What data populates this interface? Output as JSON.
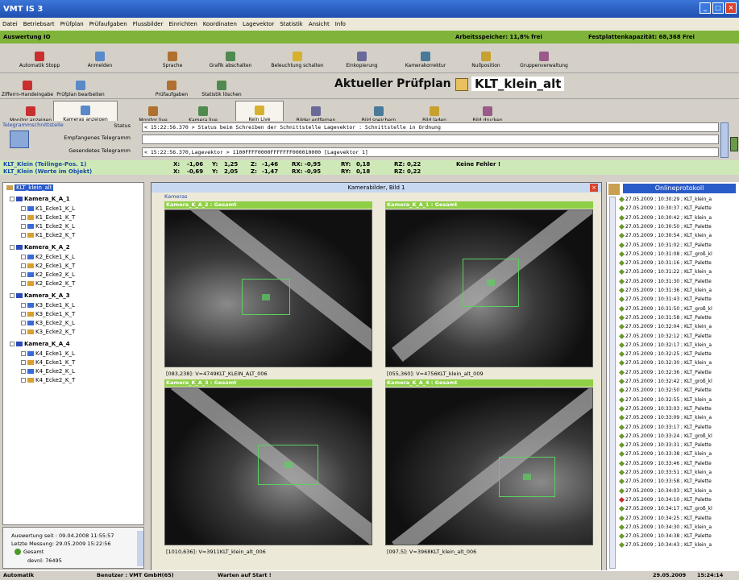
{
  "window": {
    "title": "VMT IS 3"
  },
  "menu": [
    "Datei",
    "Betriebsart",
    "Prüfplan",
    "Prüfaufgaben",
    "Flussbilder",
    "Einrichten",
    "Koordinaten",
    "Lagevektor",
    "Statistik",
    "Ansicht",
    "Info"
  ],
  "greenbar": {
    "left": "Auswertung IO",
    "memory": "Arbeitsspeicher: 11,8% frei",
    "disk": "Festplattenkapazität: 68,368 Frei"
  },
  "toolbar1": [
    {
      "label": "Automatik Stopp",
      "icon": "stop-icon"
    },
    {
      "label": "Anmelden",
      "icon": "user-icon"
    },
    {
      "label": "Sprache",
      "icon": "language-icon"
    },
    {
      "label": "Grafik abschalten",
      "icon": "graphic-icon"
    },
    {
      "label": "Beleuchtung schalten",
      "icon": "light-icon"
    },
    {
      "label": "Einkopierung",
      "icon": "copy-icon"
    },
    {
      "label": "Kamerakorrektur",
      "icon": "camera-correct-icon"
    },
    {
      "label": "Nullposition",
      "icon": "zero-icon"
    },
    {
      "label": "Gruppenverwaltung",
      "icon": "group-icon"
    }
  ],
  "toolbar2": [
    {
      "label": "Zifferrn-Handeingabe",
      "icon": "keypad-icon"
    },
    {
      "label": "Prüfplan bearbeiten",
      "icon": "edit-icon"
    },
    {
      "label": "Prüfaufgaben",
      "icon": "tasks-icon"
    },
    {
      "label": "Statistik löschen",
      "icon": "delete-stats-icon"
    }
  ],
  "plan": {
    "heading": "Aktueller Prüfplan",
    "name": "KLT_klein_alt"
  },
  "toolbar3": [
    {
      "label": "Monitor anzeigen",
      "icon": "monitor-icon"
    },
    {
      "label": "Kameras anzeigen",
      "icon": "cameras-icon",
      "pressed": true
    },
    {
      "label": "Monitor live",
      "icon": "monitor-live-icon"
    },
    {
      "label": "Kamera live",
      "icon": "camera-live-icon"
    },
    {
      "label": "Kein Live",
      "icon": "no-live-icon",
      "pressed": true
    },
    {
      "label": "Bilder entfernen",
      "icon": "remove-images-icon"
    },
    {
      "label": "Bild speichern",
      "icon": "save-image-icon"
    },
    {
      "label": "Bild laden",
      "icon": "load-image-icon"
    },
    {
      "label": "Bild drucken",
      "icon": "print-image-icon"
    }
  ],
  "telegram": {
    "section": "Telegrammschnittstelle",
    "status_label": "Status",
    "status": "< 15:22:56.370 > Status beim Schreiben der Schnittstelle Lagevektor :  Schnittstelle in Ordnung",
    "received_label": "Empfangenes Telegramm",
    "received": "",
    "sent_label": "Gesendetes Telegramm",
    "sent": "< 15:22:56.370,Lagevektor > 1100FFFF0000FFFFFFF000010000 [Lagevektor 1]"
  },
  "coord": [
    {
      "name": "KLT_Klein (Teilinge-Pos. 1)",
      "x": "-1,06",
      "y": "1,25",
      "z": "-1,46",
      "rx": "-0,95",
      "ry": "0,18",
      "rz": "0,22",
      "msg": "Keine Fehler !"
    },
    {
      "name": "KLT_Klein (Werte im Objekt)",
      "x": "-0,69",
      "y": "2,05",
      "z": "-1,47",
      "rx": "-0,95",
      "ry": "0,18",
      "rz": "0,22",
      "msg": ""
    }
  ],
  "coord_labels": {
    "x": "X:",
    "y": "Y:",
    "z": "Z:",
    "rx": "RX:",
    "ry": "RY:",
    "rz": "RZ:"
  },
  "tree": {
    "root": "KLT_klein_alt",
    "cameras": [
      {
        "name": "Kamera_K_A_1",
        "items": [
          "K1_Ecke1_K_L",
          "K1_Ecke1_K_T",
          "K1_Ecke2_K_L",
          "K1_Ecke2_K_T"
        ]
      },
      {
        "name": "Kamera_K_A_2",
        "items": [
          "K2_Ecke1_K_L",
          "K2_Ecke1_K_T",
          "K2_Ecke2_K_L",
          "K2_Ecke2_K_T"
        ]
      },
      {
        "name": "Kamera_K_A_3",
        "items": [
          "K3_Ecke1_K_L",
          "K3_Ecke1_K_T",
          "K3_Ecke2_K_L",
          "K3_Ecke2_K_T"
        ]
      },
      {
        "name": "Kamera_K_A_4",
        "items": [
          "K4_Ecke1_K_L",
          "K4_Ecke1_K_T",
          "K4_Ecke2_K_L",
          "K4_Ecke2_K_T"
        ]
      }
    ]
  },
  "leftinfo": {
    "line1": "Auswertung seit : 09.04.2008 11:55:57",
    "line2": "Letzte Messung: 29.05.2009 15:22:56",
    "line3": "Gesamt",
    "line4": "devnl: 76495"
  },
  "camwin": {
    "title": "Kamerabilder, Bild 1",
    "group": "Kameras",
    "cams": [
      {
        "caption": "Kamera_K_A_2 : Gesamt",
        "label": "[083,238]: V=4749KLT_KLEIN_ALT_006"
      },
      {
        "caption": "Kamera_K_A_1 : Gesamt",
        "label": "[055,360]: V=4756KLT_klein_alt_009"
      },
      {
        "caption": "Kamera_K_A_3 : Gesamt",
        "label": "[1010,636]: V=3911KLT_klein_alt_006"
      },
      {
        "caption": "Kamera_K_A_4 : Gesamt",
        "label": "[097,5]: V=3968KLT_klein_alt_006"
      }
    ]
  },
  "onlineprotokoll": {
    "title": "Onlineprotokoll",
    "rows": [
      "27.05.2009 ; 10:30:29 ; KLT_klein_a",
      "27.05.2009 ; 10:30:37 ; KLT_Palette",
      "27.05.2009 ; 10:30:42 ; KLT_klein_a",
      "27.05.2009 ; 10:30:50 ; KLT_Palette",
      "27.05.2009 ; 10:30:54 ; KLT_klein_a",
      "27.05.2009 ; 10:31:02 ; KLT_Palette",
      "27.05.2009 ; 10:31:08 ; KLT_groß_kl",
      "27.05.2009 ; 10:31:16 ; KLT_Palette",
      "27.05.2009 ; 10:31:22 ; KLT_klein_a",
      "27.05.2009 ; 10:31:30 ; KLT_Palette",
      "27.05.2009 ; 10:31:36 ; KLT_klein_a",
      "27.05.2009 ; 10:31:43 ; KLT_Palette",
      "27.05.2009 ; 10:31:50 ; KLT_groß_kl",
      "27.05.2009 ; 10:31:58 ; KLT_Palette",
      "27.05.2009 ; 10:32:04 ; KLT_klein_a",
      "27.05.2009 ; 10:32:12 ; KLT_Palette",
      "27.05.2009 ; 10:32:17 ; KLT_klein_a",
      "27.05.2009 ; 10:32:25 ; KLT_Palette",
      "27.05.2009 ; 10:32:30 ; KLT_klein_a",
      "27.05.2009 ; 10:32:36 ; KLT_Palette",
      "27.05.2009 ; 10:32:42 ; KLT_groß_kl",
      "27.05.2009 ; 10:32:50 ; KLT_Palette",
      "27.05.2009 ; 10:32:55 ; KLT_klein_a",
      "27.05.2009 ; 10:33:03 ; KLT_Palette",
      "27.05.2009 ; 10:33:09 ; KLT_klein_a",
      "27.05.2009 ; 10:33:17 ; KLT_Palette",
      "27.05.2009 ; 10:33:24 ; KLT_groß_kl",
      "27.05.2009 ; 10:33:31 ; KLT_Palette",
      "27.05.2009 ; 10:33:38 ; KLT_klein_a",
      "27.05.2009 ; 10:33:46 ; KLT_Palette",
      "27.05.2009 ; 10:33:51 ; KLT_klein_a",
      "27.05.2009 ; 10:33:58 ; KLT_Palette",
      "27.05.2009 ; 10:34:03 ; KLT_klein_a",
      "27.05.2009 ; 10:34:10 ; KLT_Palette",
      "27.05.2009 ; 10:34:17 ; KLT_groß_kl",
      "27.05.2009 ; 10:34:25 ; KLT_Palette",
      "27.05.2009 ; 10:34:30 ; KLT_klein_a",
      "27.05.2009 ; 10:34:38 ; KLT_Palette",
      "27.05.2009 ; 10:34:43 ; KLT_klein_a"
    ]
  },
  "status": {
    "mode": "Automatik",
    "user": "Benutzer : VMT GmbH(65)",
    "msg": "Warten auf Start !",
    "date": "29.05.2009",
    "time": "15:24:14"
  }
}
